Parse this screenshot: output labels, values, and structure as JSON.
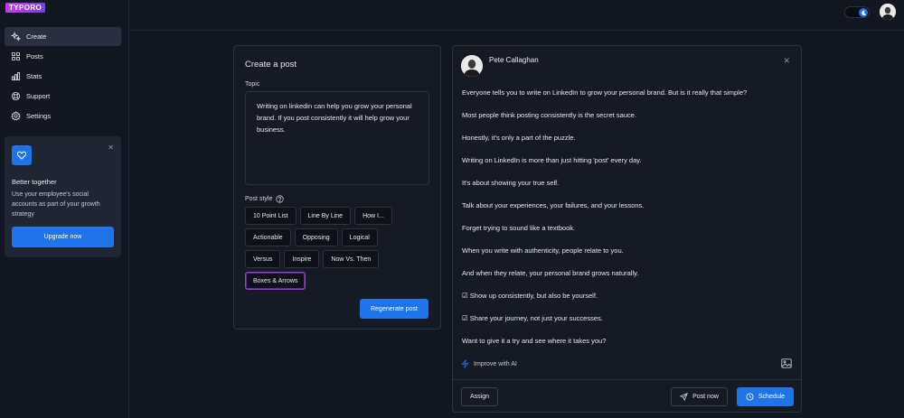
{
  "app": {
    "logo": "TYPORO"
  },
  "sidebar": {
    "items": [
      {
        "label": "Create",
        "icon": "sparkles-icon"
      },
      {
        "label": "Posts",
        "icon": "grid-icon"
      },
      {
        "label": "Stats",
        "icon": "bar-chart-icon"
      },
      {
        "label": "Support",
        "icon": "lifebuoy-icon"
      },
      {
        "label": "Settings",
        "icon": "gear-icon"
      }
    ],
    "promo": {
      "title": "Better together",
      "text": "Use your employee's social accounts as part of your growth strategy",
      "button": "Upgrade now"
    }
  },
  "create": {
    "title": "Create a post",
    "topic_label": "Topic",
    "topic_value": "Writing on linkedin can help you grow your personal brand. If you post consistently it will help grow your business.",
    "style_label": "Post style",
    "styles": [
      [
        "10 Point List",
        "Line By Line",
        "How I..."
      ],
      [
        "Actionable",
        "Opposing",
        "Logical"
      ],
      [
        "Versus",
        "Inspire",
        "Now Vs. Then"
      ],
      [
        "Boxes & Arrows"
      ]
    ],
    "selected_style": "Boxes & Arrows",
    "regenerate": "Regenerate post"
  },
  "post": {
    "author": "Pete Callaghan",
    "lines": [
      "Everyone tells you to write on LinkedIn to grow your personal brand. But is it really that simple?",
      "Most people think posting consistently is the secret sauce.",
      "Honestly, it's only a part of the puzzle.",
      "Writing on LinkedIn is more than just hitting 'post' every day.",
      "It's about showing your true self.",
      "Talk about your experiences, your failures, and your lessons.",
      "Forget trying to sound like a textbook.",
      "When you write with authenticity, people relate to you.",
      "And when they relate, your personal brand grows naturally.",
      "☑ Show up consistently, but also be yourself.",
      "☑ Share your journey, not just your successes.",
      "Want to give it a try and see where it takes you?"
    ],
    "improve": "Improve with AI",
    "assign": "Assign",
    "post_now": "Post now",
    "schedule": "Schedule"
  },
  "colors": {
    "accent": "#1e74e8",
    "background": "#131722",
    "selected_border": "#a03ad8"
  }
}
